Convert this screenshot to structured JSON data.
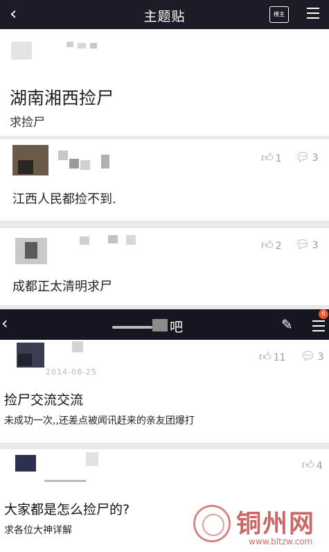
{
  "top_bar": {
    "back_icon": "chevron-left-icon",
    "title": "主题贴",
    "owner_label": "楼主",
    "more_icon": "menu-icon"
  },
  "post": {
    "title": "湖南湘西捡尸",
    "subtitle": "求捡尸"
  },
  "replies": [
    {
      "text": "江西人民都捡不到.",
      "likes": "1",
      "comments": "3"
    },
    {
      "text": "成都正太清明求尸",
      "likes": "2",
      "comments": "3"
    }
  ],
  "forum_bar": {
    "back_icon": "chevron-left-icon",
    "forum_suffix": "吧",
    "edit_icon": "edit-icon",
    "menu_icon": "menu-icon",
    "badge": "6"
  },
  "threads": [
    {
      "date": "2014-08-25",
      "likes": "11",
      "comments": "3",
      "title": "捡尸交流交流",
      "subtitle": "未成功一次,,还差点被闻讯赶来的亲友团爆打"
    },
    {
      "likes": "4",
      "title": "大家都是怎么捡尸的?",
      "subtitle": "求各位大神详解"
    }
  ],
  "watermark": {
    "name": "铜州网",
    "url": "www.bltzw.com"
  },
  "colors": {
    "top_bar": "#1b1d26",
    "background": "#e9e9eb",
    "stat_gray": "#9a9a9a",
    "watermark_red": "#be3c3c"
  }
}
